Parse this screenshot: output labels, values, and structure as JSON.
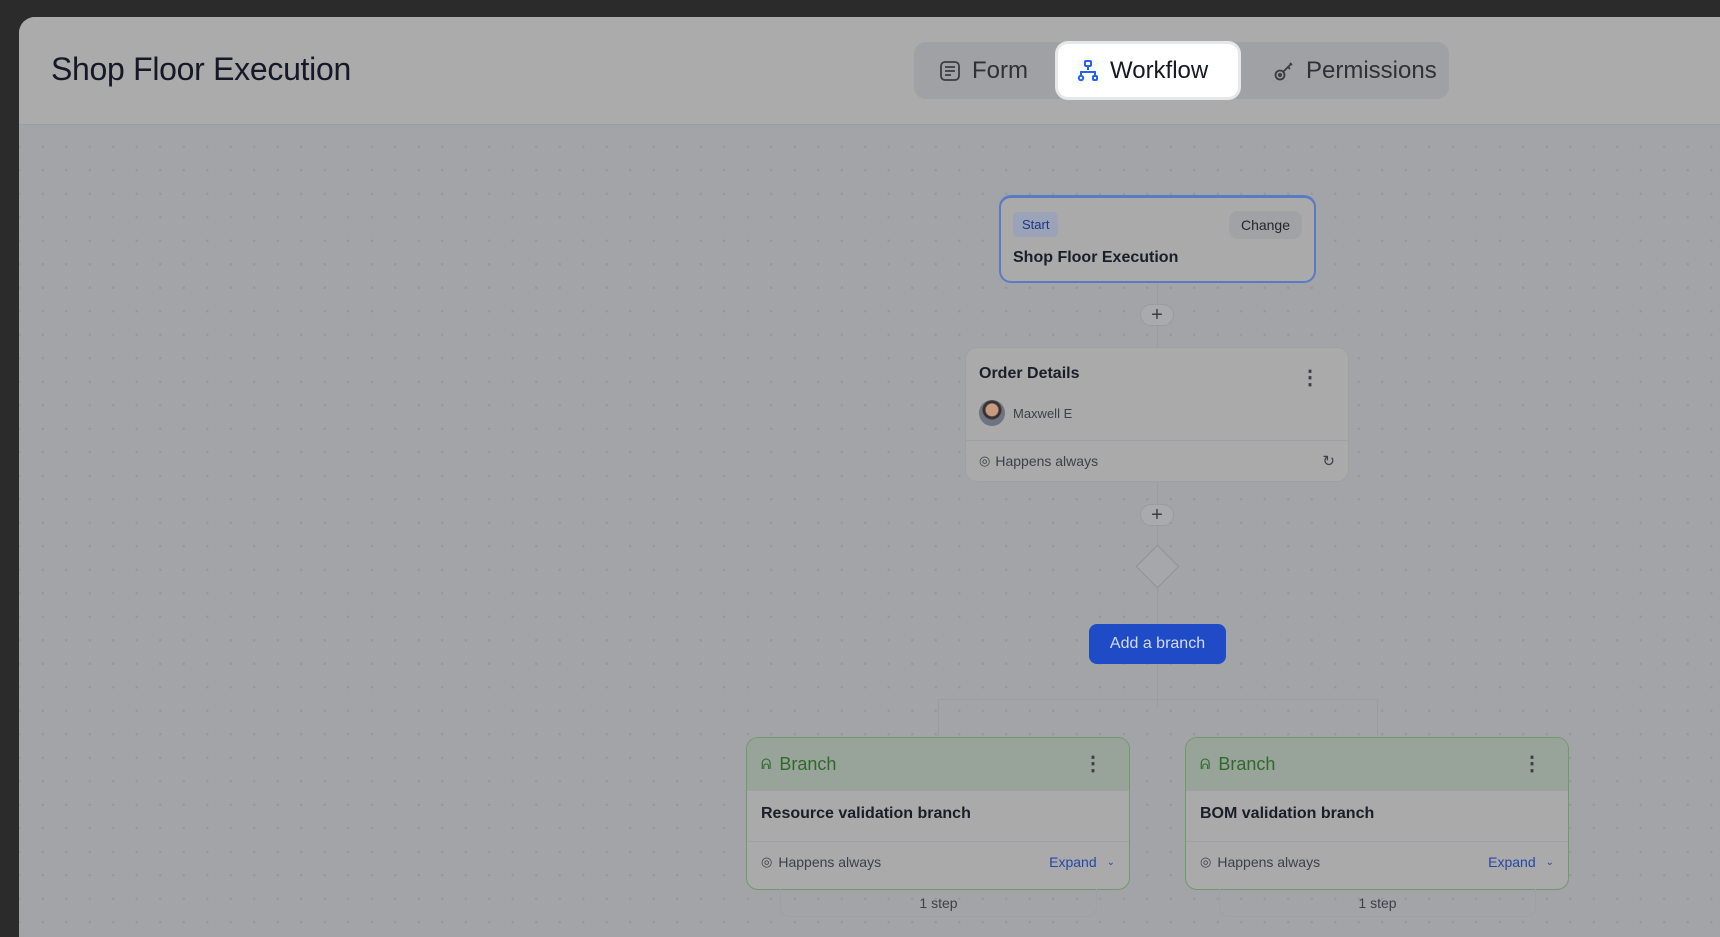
{
  "header": {
    "title": "Shop Floor Execution"
  },
  "tabs": [
    {
      "label": "Form",
      "icon": "form-icon"
    },
    {
      "label": "Workflow",
      "icon": "workflow-icon",
      "active": true
    },
    {
      "label": "Permissions",
      "icon": "key-icon"
    }
  ],
  "start_node": {
    "badge": "Start",
    "change_label": "Change",
    "name": "Shop Floor Execution"
  },
  "step_node": {
    "title": "Order Details",
    "assignee": "Maxwell E",
    "condition": "Happens always"
  },
  "add_branch_label": "Add a branch",
  "branches": [
    {
      "type": "Branch",
      "name": "Resource validation branch",
      "condition": "Happens always",
      "expand_label": "Expand",
      "steps": "1 step"
    },
    {
      "type": "Branch",
      "name": "BOM validation branch",
      "condition": "Happens always",
      "expand_label": "Expand",
      "steps": "1 step"
    }
  ],
  "colors": {
    "accent": "#1f4bc6",
    "branch_green": "#2f6a2c"
  }
}
